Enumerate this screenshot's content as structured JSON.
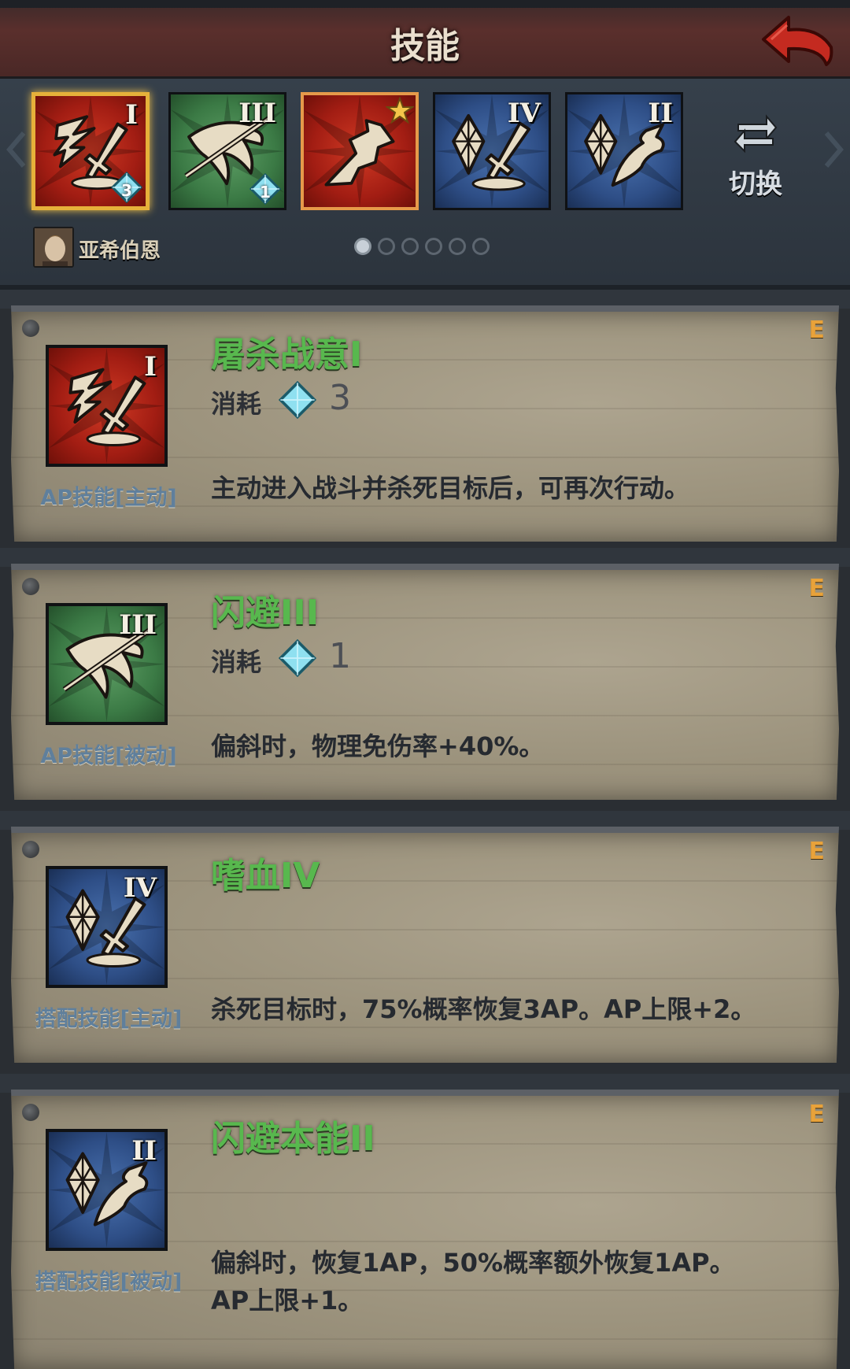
{
  "header": {
    "title": "技能"
  },
  "strip": {
    "slots": [
      {
        "roman": "I",
        "gem": "3"
      },
      {
        "roman": "III",
        "gem": "1"
      },
      {
        "roman": ""
      },
      {
        "roman": "IV"
      },
      {
        "roman": "II"
      }
    ],
    "switch_label": "切换",
    "hero_name": "亚希伯恩",
    "page_count": 6,
    "active_page": 1
  },
  "cards": [
    {
      "grade": "E",
      "name": "屠杀战意I",
      "cost_label": "消耗",
      "cost": "3",
      "type": "AP技能[主动]",
      "roman": "I",
      "desc": "主动进入战斗并杀死目标后，可再次行动。"
    },
    {
      "grade": "E",
      "name": "闪避III",
      "cost_label": "消耗",
      "cost": "1",
      "type": "AP技能[被动]",
      "roman": "III",
      "desc": "偏斜时，物理免伤率+40%。"
    },
    {
      "grade": "E",
      "name": "嗜血IV",
      "type": "搭配技能[主动]",
      "roman": "IV",
      "desc": "杀死目标时，75%概率恢复3AP。AP上限+2。"
    },
    {
      "grade": "E",
      "name": "闪避本能II",
      "type": "搭配技能[被动]",
      "roman": "II",
      "desc_line1": "偏斜时，恢复1AP，50%概率额外恢复1AP。",
      "desc_line2": "AP上限+1。"
    }
  ],
  "colors": {
    "accent_gold": "#e6b13a",
    "skill_name_green": "#58b84e",
    "type_blue": "#5f7f9c",
    "grade_orange": "#e8a23a",
    "icon_red": "#a21d13",
    "icon_green": "#3b7a45",
    "icon_blue": "#2e4e86"
  },
  "icons": [
    "back-arrow-icon",
    "slaughter-icon",
    "dodge-icon",
    "bloodthirst-icon",
    "dodge-instinct-icon",
    "star-icon",
    "gem-icon",
    "switch-icon",
    "chevron-left-icon",
    "chevron-right-icon"
  ]
}
